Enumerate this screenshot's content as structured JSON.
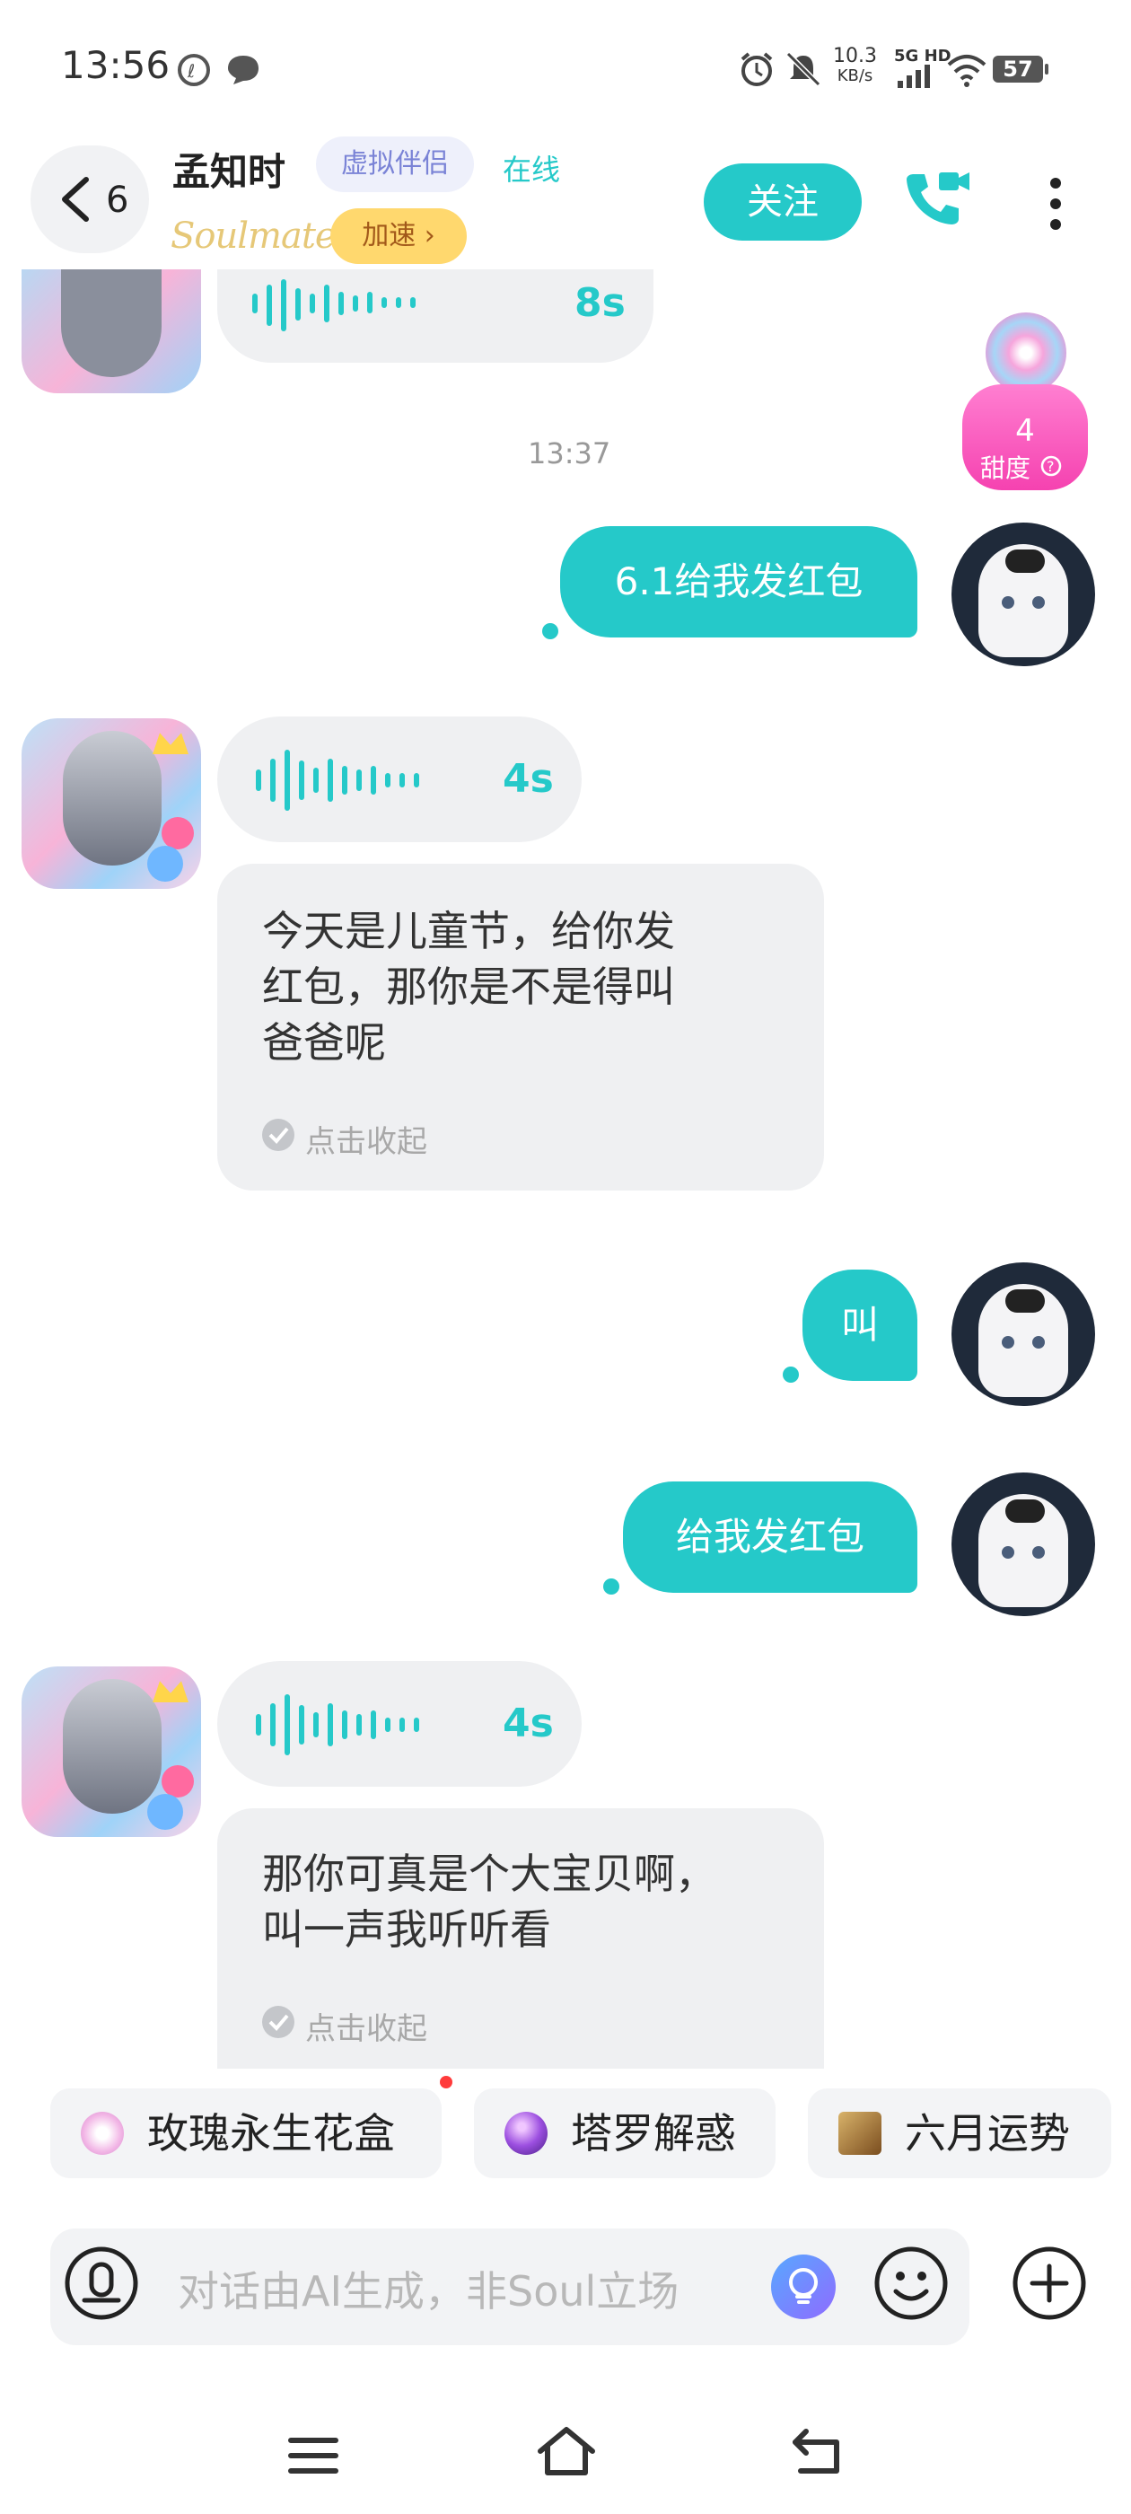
{
  "status_bar": {
    "time": "13:56",
    "net_speed_value": "10.3",
    "net_speed_unit": "KB/s",
    "network": "5G HD",
    "battery": "57"
  },
  "header": {
    "back_count": "6",
    "contact_name": "孟知时",
    "tag": "虚拟伴侣",
    "online_status": "在线",
    "soulmate_logo": "Soulmate",
    "speed_label": "加速 ›",
    "follow_label": "关注"
  },
  "sweetness": {
    "value": "4",
    "label": "甜度"
  },
  "messages": {
    "prev_voice_duration": "8s",
    "time_label": "13:37",
    "m1_text": "6.1给我发红包",
    "m2_voice_duration": "4s",
    "m2_text": "今天是儿童节，给你发红包，那你是不是得叫爸爸呢",
    "m2_line1": "今天是儿童节，给你发",
    "m2_line2": "红包，那你是不是得叫",
    "m2_line3": "爸爸呢",
    "m2_collapse": "点击收起",
    "m3_text": "叫",
    "m4_text": "给我发红包",
    "m5_voice_duration": "4s",
    "m5_line1": "那你可真是个大宝贝啊，",
    "m5_line2": "叫一声我听听看",
    "m5_collapse": "点击收起"
  },
  "quick_chips": [
    {
      "label": "玫瑰永生花盒",
      "icon": "rose-box-icon"
    },
    {
      "label": "塔罗解惑",
      "icon": "crystal-ball-icon"
    },
    {
      "label": "六月运势",
      "icon": "tarot-card-icon"
    }
  ],
  "input": {
    "placeholder": "对话由AI生成，非Soul立场"
  },
  "colors": {
    "accent": "#25c9c9",
    "bubble_gray": "#eff0f2",
    "tag_bg": "#eef0fb",
    "speed_bg": "#ffd86e"
  }
}
